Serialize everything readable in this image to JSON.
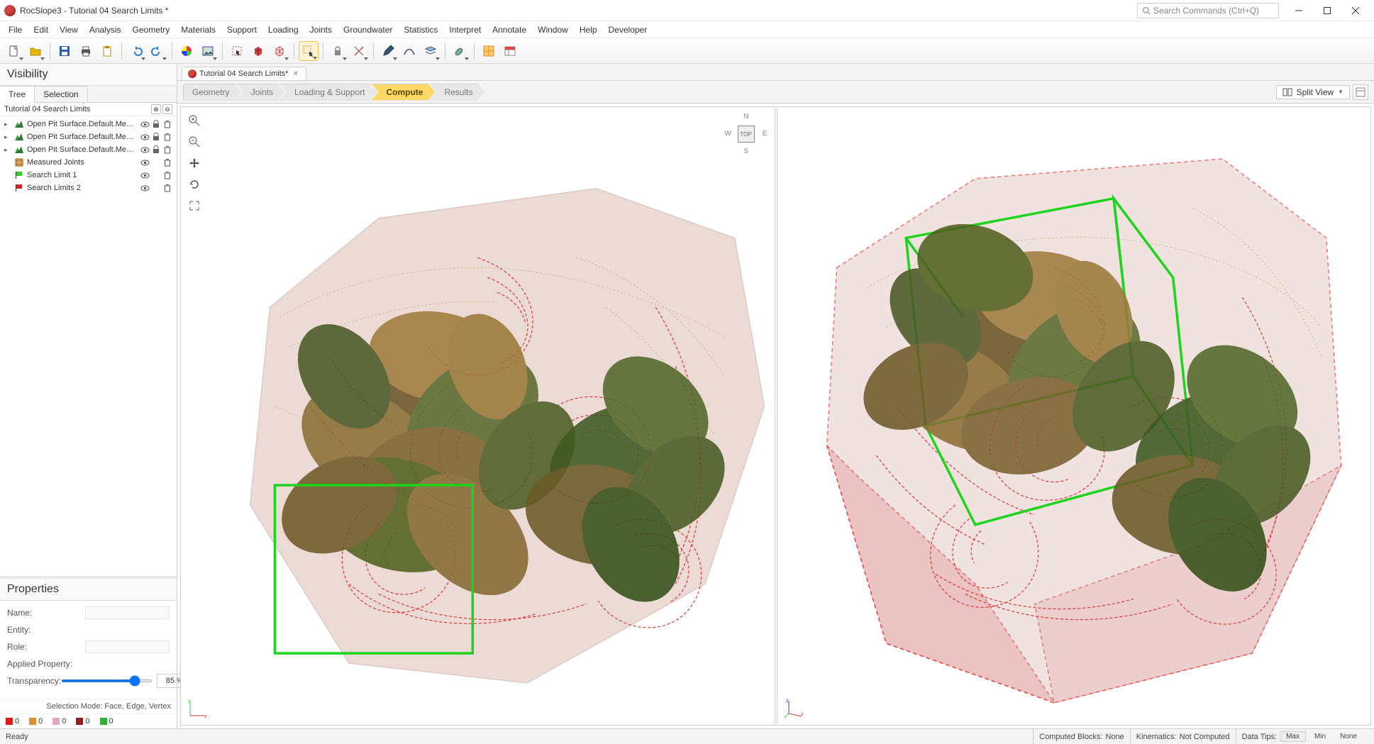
{
  "app": {
    "title": "RocSlope3 - Tutorial 04 Search Limits *",
    "search_placeholder": "Search Commands (Ctrl+Q)"
  },
  "menu": [
    "File",
    "Edit",
    "View",
    "Analysis",
    "Geometry",
    "Materials",
    "Support",
    "Loading",
    "Joints",
    "Groundwater",
    "Statistics",
    "Interpret",
    "Annotate",
    "Window",
    "Help",
    "Developer"
  ],
  "doctab": {
    "label": "Tutorial 04 Search Limits*"
  },
  "workflow": {
    "steps": [
      "Geometry",
      "Joints",
      "Loading & Support",
      "Compute",
      "Results"
    ],
    "active_index": 3,
    "view_mode": "Split View"
  },
  "visibility": {
    "title": "Visibility",
    "tabs": [
      "Tree",
      "Selection"
    ],
    "active_tab": 0,
    "root": "Tutorial 04 Search Limits",
    "nodes": [
      {
        "icon": "terrain",
        "label": "Open Pit Surface.Default.Mesh_ext.",
        "expand": true,
        "eye": true,
        "lock": true,
        "del": true
      },
      {
        "icon": "terrain",
        "label": "Open Pit Surface.Default.Mesh_ext.",
        "expand": true,
        "eye": true,
        "lock": true,
        "del": true
      },
      {
        "icon": "terrain",
        "label": "Open Pit Surface.Default.Mesh_ext.",
        "expand": true,
        "eye": true,
        "lock": true,
        "del": true
      },
      {
        "icon": "joints",
        "label": "Measured Joints",
        "expand": false,
        "eye": true,
        "lock": false,
        "del": true
      },
      {
        "icon": "flag-green",
        "label": "Search Limit 1",
        "expand": false,
        "eye": true,
        "lock": false,
        "del": true
      },
      {
        "icon": "flag-red",
        "label": "Search Limits 2",
        "expand": false,
        "eye": true,
        "lock": false,
        "del": true
      }
    ]
  },
  "properties": {
    "title": "Properties",
    "labels": {
      "name": "Name:",
      "entity": "Entity:",
      "role": "Role:",
      "applied": "Applied Property:",
      "transparency": "Transparency:"
    },
    "transparency_value": "85 %"
  },
  "selection_mode": "Selection Mode: Face, Edge, Vertex",
  "counts": [
    {
      "color": "#e01818",
      "value": "0"
    },
    {
      "color": "#d89030",
      "value": "0"
    },
    {
      "color": "#e4a8c0",
      "value": "0"
    },
    {
      "color": "#902020",
      "value": "0"
    },
    {
      "color": "#30b030",
      "value": "0"
    }
  ],
  "compass": {
    "top": "TOP",
    "n": "N",
    "s": "S",
    "e": "E",
    "w": "W"
  },
  "status": {
    "ready": "Ready",
    "computed_blocks_label": "Computed Blocks:",
    "computed_blocks_value": "None",
    "kinematics_label": "Kinematics:",
    "kinematics_value": "Not Computed",
    "datatips_label": "Data Tips:",
    "max": "Max",
    "min": "Min",
    "none": "None"
  }
}
